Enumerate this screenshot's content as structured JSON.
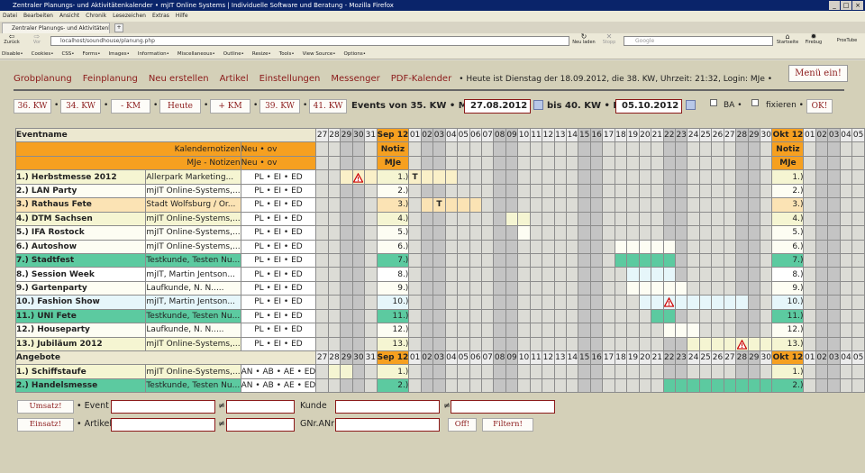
{
  "browser": {
    "title": "Zentraler Planungs- und Aktivitätenkalender • mjIT Online Systems | Individuelle Software und Beratung - Mozilla Firefox",
    "menu": [
      "Datei",
      "Bearbeiten",
      "Ansicht",
      "Chronik",
      "Lesezeichen",
      "Extras",
      "Hilfe"
    ],
    "tab_label": "Zentraler Planungs- und Aktivitätenkalender ...",
    "tab_plus": "+",
    "back": "Zurück",
    "forward": "Vor",
    "reload": "Neu laden",
    "stop": "Stopp",
    "url": "localhost/soundhouse/planung.php",
    "search_placeholder": "Google",
    "home": "Startseite",
    "firebug": "Firebug",
    "proxtube": "ProxTube",
    "devbar": [
      "Disable•",
      "Cookies•",
      "CSS•",
      "Forms•",
      "Images•",
      "Information•",
      "Miscellaneous•",
      "Outline•",
      "Resize•",
      "Tools•",
      "View Source•",
      "Options•"
    ]
  },
  "nav": {
    "items": [
      "Grobplanung",
      "Feinplanung",
      "Neu erstellen",
      "Artikel",
      "Einstellungen",
      "Messenger",
      "PDF-Kalender"
    ],
    "info": "• Heute ist Dienstag der 18.09.2012, die 38. KW, Uhrzeit: 21:32, Login: MJe •",
    "menu_button": "Menü ein!"
  },
  "toolbar": {
    "kw_buttons": [
      "36. KW",
      "34. KW",
      "- KM",
      "Heute",
      "+ KM",
      "39. KW",
      "41. KW"
    ],
    "events_label": "Events von 35. KW • Mo:",
    "start_date": "27.08.2012",
    "mid_label": "bis 40. KW • Fr:",
    "end_date": "05.10.2012",
    "ba_label": "BA •",
    "fix_label": "fixieren •",
    "ok": "OK!"
  },
  "grid": {
    "days_header": [
      "27",
      "28",
      "29",
      "30",
      "31",
      "Sep 12",
      "01",
      "02",
      "03",
      "04",
      "05",
      "06",
      "07",
      "08",
      "09",
      "10",
      "11",
      "12",
      "13",
      "14",
      "15",
      "16",
      "17",
      "18",
      "19",
      "20",
      "21",
      "22",
      "23",
      "24",
      "25",
      "26",
      "27",
      "28",
      "29",
      "30",
      "Okt 12",
      "01",
      "02",
      "03",
      "04",
      "05"
    ],
    "weekend": [
      0,
      0,
      1,
      1,
      0,
      0,
      0,
      1,
      1,
      0,
      0,
      0,
      0,
      1,
      1,
      0,
      0,
      0,
      0,
      0,
      1,
      1,
      0,
      0,
      0,
      0,
      0,
      1,
      1,
      0,
      0,
      0,
      0,
      1,
      1,
      0,
      0,
      0,
      1,
      1,
      0,
      0
    ],
    "event_title": "Eventname",
    "kalender_notes": "Kalendernotizen",
    "mje_notes": "MJe - Notizen",
    "neu": "Neu • ov",
    "notiz": "Notiz",
    "mje": "MJe",
    "events": [
      {
        "name": "1.) Herbstmesse 2012",
        "loc": "Allerpark Marketing...",
        "flags": "PL • EI • ED",
        "num": "1.)",
        "row": "#f5f5d2",
        "cells": {
          "2": "#faf0c8",
          "3": "#faf0c8",
          "4": "#faf0c8",
          "5": "#faf0c8",
          "6": "#faf0c8",
          "7": "#faf0c8",
          "8": "#faf0c8",
          "9": "#faf0c8"
        },
        "marks": {
          "3": "warn",
          "6": "T"
        }
      },
      {
        "name": "2.) LAN Party",
        "loc": "mjIT Online-Systems,...",
        "flags": "PL • EI • ED",
        "num": "2.)",
        "row": "#fdfdf3",
        "cells": {},
        "marks": {}
      },
      {
        "name": "3.) Rathaus Fete",
        "loc": "Stadt Wolfsburg / Or...",
        "flags": "PL • EI • ED",
        "num": "3.)",
        "row": "#fbe3b4",
        "cells": {
          "7": "#fbe3b4",
          "8": "#fbe3b4",
          "9": "#fbe3b4",
          "10": "#fbe3b4",
          "11": "#fbe3b4"
        },
        "marks": {
          "8": "T"
        }
      },
      {
        "name": "4.) DTM Sachsen",
        "loc": "mjIT Online-Systems,...",
        "flags": "PL • EI • ED",
        "num": "4.)",
        "row": "#f5f5d2",
        "cells": {
          "14": "#f5f5d2",
          "15": "#f5f5d2"
        },
        "marks": {}
      },
      {
        "name": "5.) IFA Rostock",
        "loc": "mjIT Online-Systems,...",
        "flags": "PL • EI • ED",
        "num": "5.)",
        "row": "#fdfdf3",
        "cells": {
          "15": "#fdfdf3"
        },
        "marks": {}
      },
      {
        "name": "6.) Autoshow",
        "loc": "mjIT Online-Systems,...",
        "flags": "PL • EI • ED",
        "num": "6.)",
        "row": "#fdfdf3",
        "cells": {
          "23": "#fdfdf3",
          "24": "#fdfdf3",
          "25": "#fdfdf3",
          "26": "#fdfdf3",
          "27": "#fdfdf3"
        },
        "marks": {}
      },
      {
        "name": "7.) Stadtfest",
        "loc": "Testkunde, Testen Nu...",
        "flags": "PL • EI • ED",
        "num": "7.)",
        "row": "#5ccaa0",
        "cells": {
          "23": "#5ccaa0",
          "24": "#5ccaa0",
          "25": "#5ccaa0",
          "26": "#5ccaa0",
          "27": "#5ccaa0"
        },
        "marks": {}
      },
      {
        "name": "8.) Session Week",
        "loc": "mjIT, Martin Jentson...",
        "flags": "PL • EI • ED",
        "num": "8.)",
        "row": "#ffffff",
        "cells": {
          "24": "#e6f6fa",
          "25": "#e6f6fa",
          "26": "#e6f6fa",
          "27": "#e6f6fa"
        },
        "marks": {}
      },
      {
        "name": "9.) Gartenparty",
        "loc": "Laufkunde, N. N.....",
        "flags": "PL • EI • ED",
        "num": "9.)",
        "row": "#fdfdf3",
        "cells": {
          "24": "#fdfdf3",
          "25": "#fdfdf3",
          "26": "#fdfdf3",
          "27": "#fdfdf3",
          "28": "#fdfdf3"
        },
        "marks": {}
      },
      {
        "name": "10.) Fashion Show",
        "loc": "mjIT, Martin Jentson...",
        "flags": "PL • EI • ED",
        "num": "10.)",
        "row": "#e6f6fa",
        "cells": {
          "25": "#e6f6fa",
          "26": "#e6f6fa",
          "27": "#e6f6fa",
          "28": "#e6f6fa",
          "29": "#e6f6fa",
          "30": "#e6f6fa",
          "31": "#e6f6fa",
          "32": "#e6f6fa",
          "33": "#e6f6fa"
        },
        "marks": {
          "27": "warn"
        }
      },
      {
        "name": "11.) UNI Fete",
        "loc": "Testkunde, Testen Nu...",
        "flags": "PL • EI • ED",
        "num": "11.)",
        "row": "#5ccaa0",
        "cells": {
          "26": "#5ccaa0",
          "27": "#5ccaa0"
        },
        "marks": {}
      },
      {
        "name": "12.) Houseparty",
        "loc": "Laufkunde, N. N.....",
        "flags": "PL • EI • ED",
        "num": "12.)",
        "row": "#fdfdf3",
        "cells": {
          "27": "#fdfdf3",
          "28": "#fdfdf3",
          "29": "#fdfdf3"
        },
        "marks": {}
      },
      {
        "name": "13.) Jubiläum 2012",
        "loc": "mjIT Online-Systems,...",
        "flags": "PL • EI • ED",
        "num": "13.)",
        "row": "#f5f5d2",
        "cells": {
          "29": "#f5f5d2",
          "30": "#f5f5d2",
          "31": "#f5f5d2",
          "32": "#f5f5d2",
          "33": "#f5f5d2",
          "34": "#f5f5d2",
          "35": "#f5f5d2"
        },
        "marks": {
          "33": "warn"
        }
      }
    ],
    "angebote_title": "Angebote",
    "offers": [
      {
        "name": "1.) Schiffstaufe",
        "loc": "mjIT Online-Systems,...",
        "flags": "AN • AB • AE • ED",
        "num": "1.)",
        "row": "#f5f5d2",
        "cells": {
          "1": "#f5f5d2",
          "2": "#f5f5d2"
        },
        "marks": {}
      },
      {
        "name": "2.) Handelsmesse",
        "loc": "Testkunde, Testen Nu...",
        "flags": "AN • AB • AE • ED",
        "num": "2.)",
        "row": "#5ccaa0",
        "cells": {
          "27": "#5ccaa0",
          "28": "#5ccaa0",
          "29": "#5ccaa0",
          "30": "#5ccaa0",
          "31": "#5ccaa0",
          "32": "#5ccaa0",
          "33": "#5ccaa0",
          "34": "#5ccaa0",
          "35": "#5ccaa0"
        },
        "marks": {}
      }
    ]
  },
  "filter": {
    "umsatz": "Umsatz!",
    "einsatz": "Einsatz!",
    "event": "• Event",
    "artikel": "• Artikel",
    "neq": "≠",
    "kunde": "Kunde",
    "gnr": "GNr.ANr",
    "off": "Off!",
    "filtern": "Filtern!"
  },
  "colors": {
    "accent": "#8b1a1a",
    "orange": "#f6a020",
    "green": "#5ccaa0"
  }
}
